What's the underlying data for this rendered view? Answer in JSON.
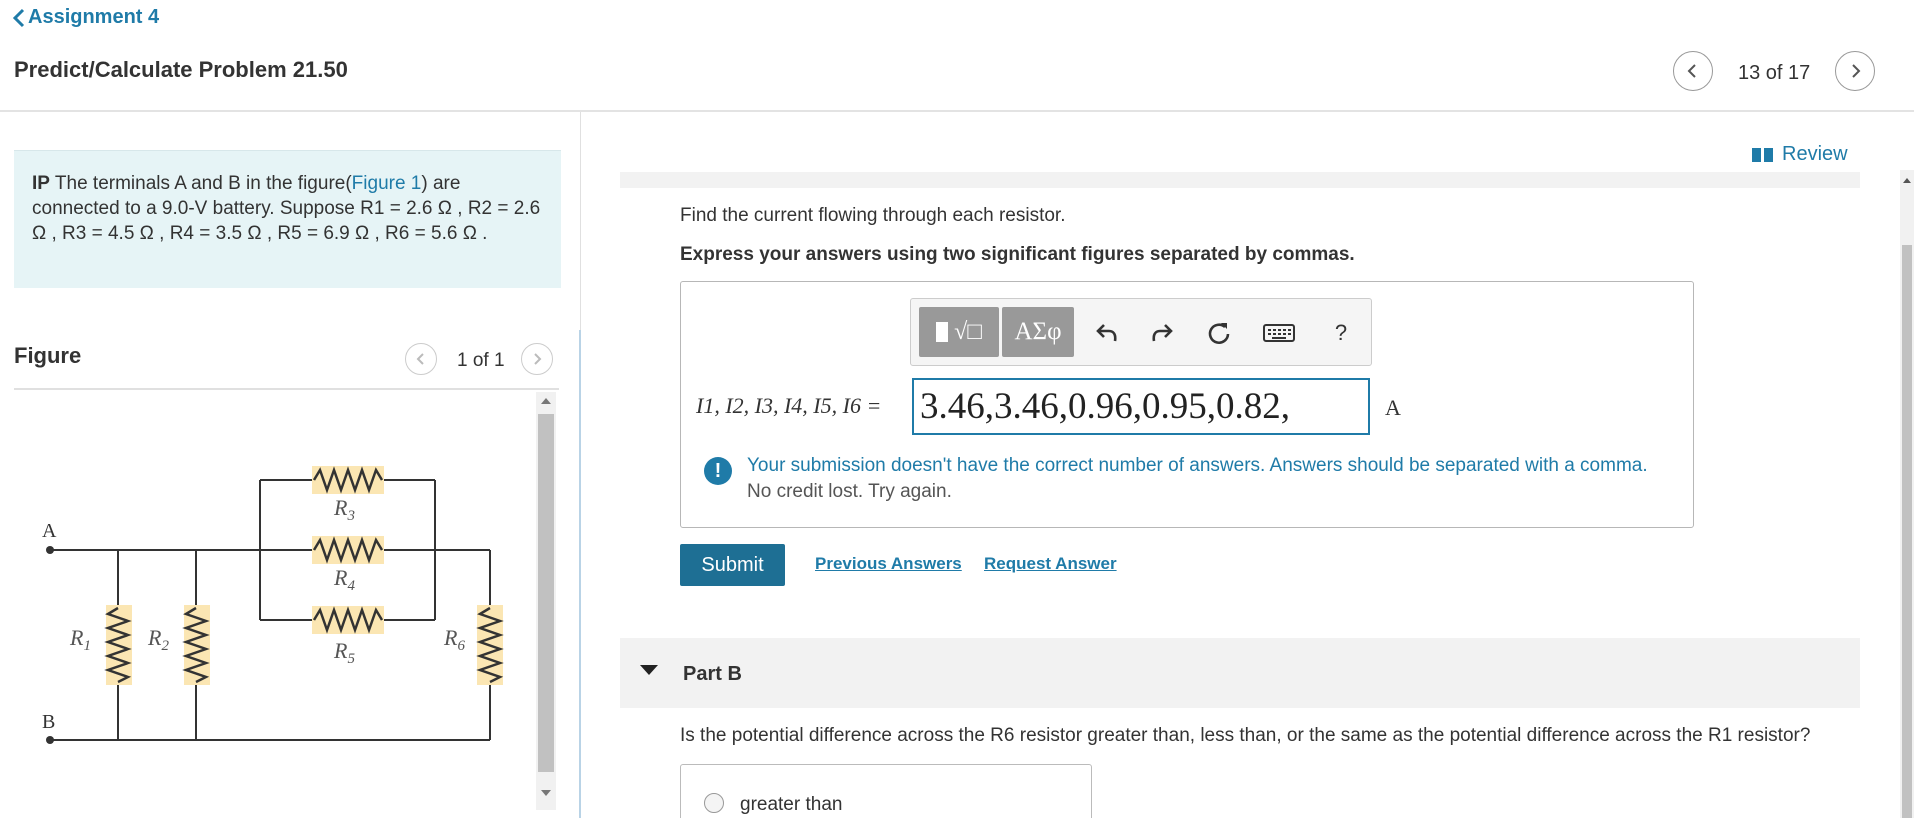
{
  "header": {
    "back_label": "Assignment 4",
    "problem_title": "Predict/Calculate Problem 21.50",
    "pager": "13 of 17"
  },
  "intro": {
    "ip_prefix": "IP",
    "text_before_link": "The terminals A and B in the figure(",
    "figure_link": "Figure 1",
    "text_after_link": ") are connected to a 9.0-V battery. Suppose R1 = 2.6 Ω , R2 = 2.6 Ω , R3 = 4.5 Ω , R4 = 3.5 Ω , R5 = 6.9 Ω , R6 = 5.6 Ω ."
  },
  "figure": {
    "label": "Figure",
    "pager": "1 of 1",
    "terminal_a": "A",
    "terminal_b": "B",
    "resistors": [
      "R1",
      "R2",
      "R3",
      "R4",
      "R5",
      "R6"
    ]
  },
  "partA": {
    "review_label": "Review",
    "question": "Find the current flowing through each resistor.",
    "instruction": "Express your answers using two significant figures separated by commas.",
    "toolbar": {
      "templates_label": "√□",
      "symbols_label": "ΑΣφ",
      "help_label": "?"
    },
    "variables_label": "I1, I2, I3, I4, I5, I6 =",
    "answer_value": "3.46,3.46,0.96,0.95,0.82,",
    "unit": "A",
    "alert_message": "Your submission doesn't have the correct number of answers. Answers should be separated with a comma.",
    "alert_sub": "No credit lost. Try again.",
    "submit_label": "Submit",
    "previous_answers_label": "Previous Answers",
    "request_answer_label": "Request Answer"
  },
  "partB": {
    "label": "Part B",
    "question": "Is the potential difference across the R6 resistor greater than, less than, or the same as the potential difference across the R1 resistor?",
    "options": [
      "greater than"
    ]
  },
  "colors": {
    "link_blue": "#1f7ba8",
    "submit_blue": "#1e6f94",
    "intro_bg": "#e6f4f6",
    "resistor_fill": "#fbe6b3"
  }
}
